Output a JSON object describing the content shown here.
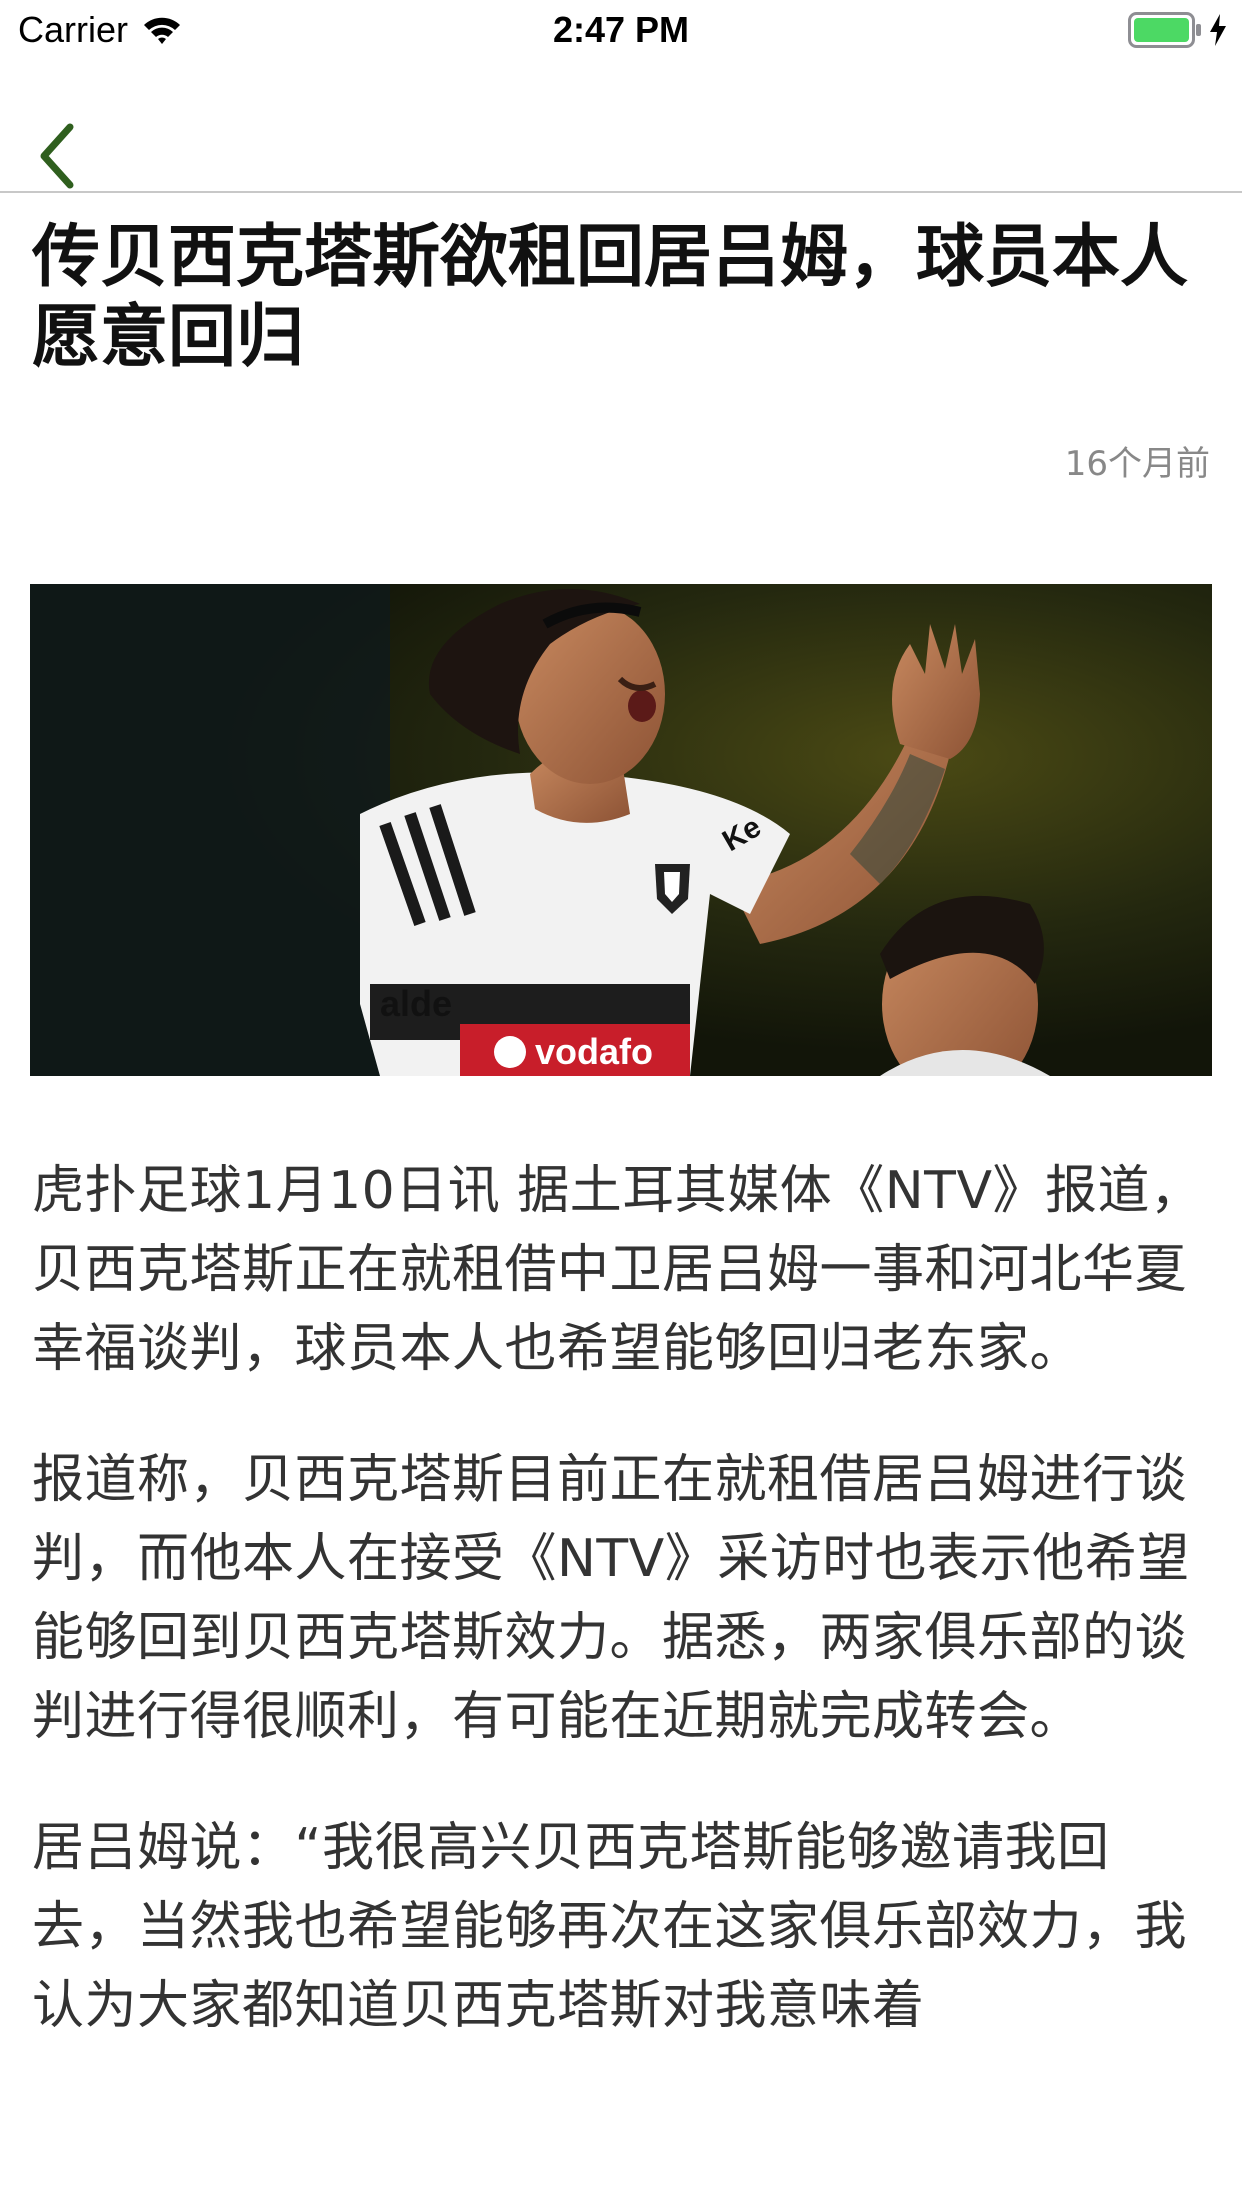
{
  "status_bar": {
    "carrier": "Carrier",
    "time": "2:47 PM",
    "battery_color": "#4cd964"
  },
  "nav": {
    "back_icon": "chevron-left-icon",
    "accent_color": "#2f5f1e"
  },
  "article": {
    "title": "传贝西克塔斯欲租回居吕姆，球员本人愿意回归",
    "time": "16个月前",
    "image": {
      "jersey_text_1": "alde",
      "jersey_text_2": "vodafo",
      "sleeve_text": "Ke"
    },
    "paragraphs": [
      "虎扑足球1月10日讯 据土耳其媒体《NTV》报道，贝西克塔斯正在就租借中卫居吕姆一事和河北华夏幸福谈判，球员本人也希望能够回归老东家。",
      "报道称，贝西克塔斯目前正在就租借居吕姆进行谈判，而他本人在接受《NTV》采访时也表示他希望能够回到贝西克塔斯效力。据悉，两家俱乐部的谈判进行得很顺利，有可能在近期就完成转会。",
      "居吕姆说：“我很高兴贝西克塔斯能够邀请我回去，当然我也希望能够再次在这家俱乐部效力，我认为大家都知道贝西克塔斯对我意味着"
    ]
  }
}
